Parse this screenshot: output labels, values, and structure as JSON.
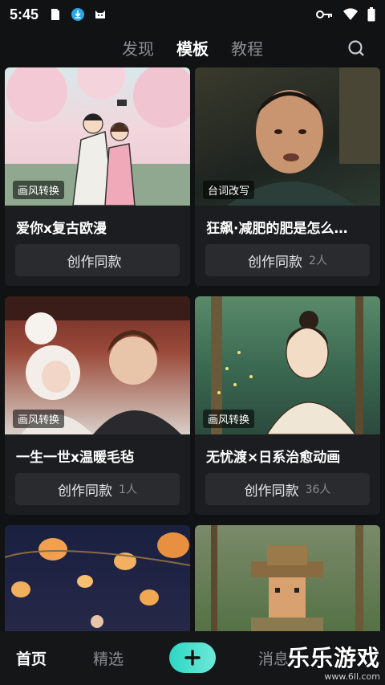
{
  "status_bar": {
    "time": "5:45"
  },
  "top_tabs": [
    {
      "label": "发现",
      "active": false
    },
    {
      "label": "模板",
      "active": true
    },
    {
      "label": "教程",
      "active": false
    }
  ],
  "cards": [
    {
      "tag": "画风转换",
      "title": "爱你x复古欧漫",
      "button": "创作同款",
      "count": ""
    },
    {
      "tag": "台词改写",
      "title": "狂飙·减肥的肥是怎么…",
      "button": "创作同款",
      "count": "2人"
    },
    {
      "tag": "画风转换",
      "title": "一生一世x温暖毛毡",
      "button": "创作同款",
      "count": "1人"
    },
    {
      "tag": "画风转换",
      "title": "无忧渡×日系治愈动画",
      "button": "创作同款",
      "count": "36人"
    }
  ],
  "bottom_nav": {
    "home": "首页",
    "featured": "精选",
    "messages": "消息"
  },
  "watermark": {
    "main": "乐乐游戏",
    "url": "www.6ll.com"
  }
}
